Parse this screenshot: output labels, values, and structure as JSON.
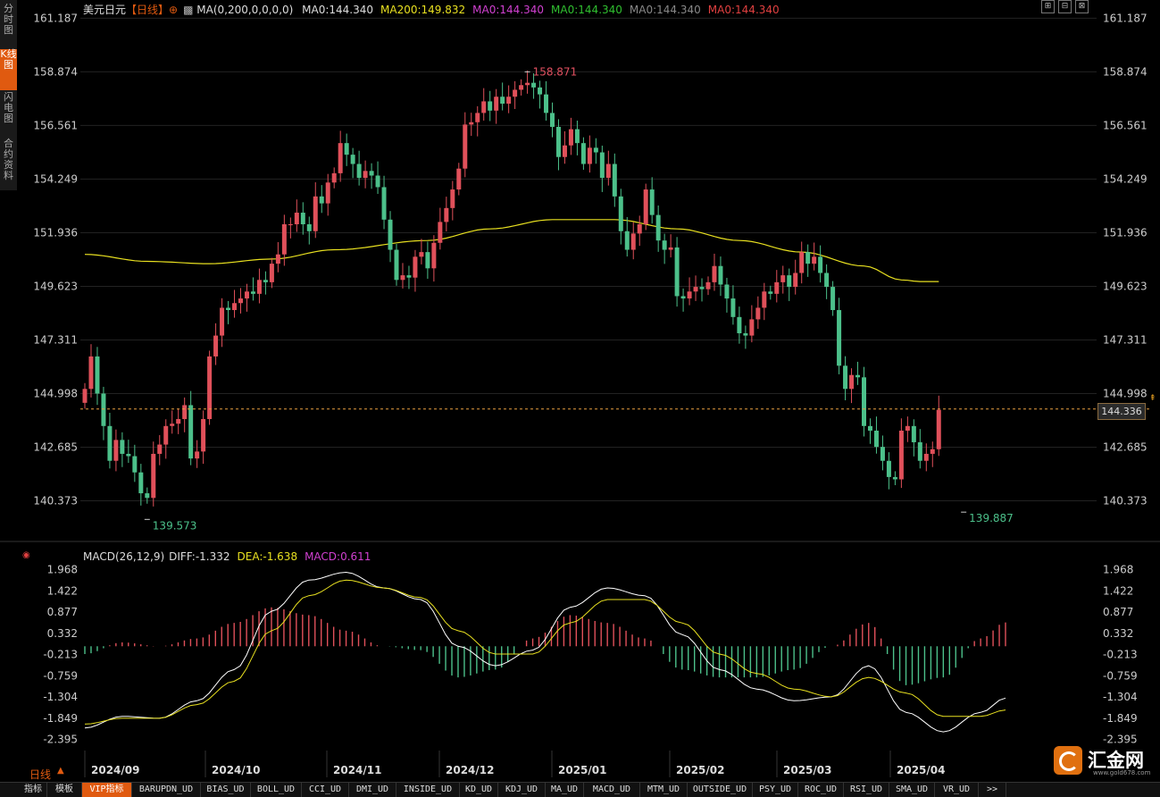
{
  "side_tabs": [
    {
      "label": "分时图",
      "active": false
    },
    {
      "label": "K线图",
      "active": true
    },
    {
      "label": "闪电图",
      "active": false
    },
    {
      "label": "合约资料",
      "active": false
    }
  ],
  "legend_main": {
    "symbol": "美元日元",
    "period": "【日线】",
    "ma_params": "MA(0,200,0,0,0,0)",
    "items": [
      {
        "text": "MA0:144.340",
        "color": "#dddddd"
      },
      {
        "text": "MA200:149.832",
        "color": "#e8e020"
      },
      {
        "text": "MA0:144.340",
        "color": "#d040d0"
      },
      {
        "text": "MA0:144.340",
        "color": "#30c030"
      },
      {
        "text": "MA0:144.340",
        "color": "#888888"
      },
      {
        "text": "MA0:144.340",
        "color": "#e04040"
      }
    ]
  },
  "legend_macd": {
    "name": "MACD(26,12,9)",
    "diff": "DIFF:-1.332",
    "dea": "DEA:-1.638",
    "macd": "MACD:0.611"
  },
  "current_price": "144.336",
  "high_label": "158.871",
  "low_labels": [
    "139.573",
    "139.887"
  ],
  "period_label": "日线",
  "window_buttons": [
    "⊞",
    "⊟",
    "⊠"
  ],
  "bottom_tabs": [
    "指标",
    "模板",
    "VIP指标",
    "BARUPDN_UD",
    "BIAS_UD",
    "BOLL_UD",
    "CCI_UD",
    "DMI_UD",
    "INSIDE_UD",
    "KD_UD",
    "KDJ_UD",
    "MA_UD",
    "MACD_UD",
    "MTM_UD",
    "OUTSIDE_UD",
    "PSY_UD",
    "ROC_UD",
    "RSI_UD",
    "SMA_UD",
    "VR_UD",
    ">>"
  ],
  "logo": {
    "text": "汇金网",
    "sub": "www.gold678.com"
  },
  "colors": {
    "up": "#e0505a",
    "down": "#4cc08a",
    "ma200": "#e8e020",
    "diff": "#ffffff",
    "dea": "#e8e020",
    "grid": "#222222"
  },
  "chart_data": [
    {
      "type": "candlestick",
      "y_ticks": [
        "161.187",
        "158.874",
        "156.561",
        "154.249",
        "151.936",
        "149.623",
        "147.311",
        "144.998",
        "142.685",
        "140.373"
      ],
      "ylim": [
        139.2,
        161.2
      ],
      "x_ticks": [
        "2024/09",
        "2024/10",
        "2024/11",
        "2024/12",
        "2025/01",
        "2025/02",
        "2025/03",
        "2025/04"
      ],
      "closes": [
        145.2,
        146.6,
        145.0,
        143.6,
        142.1,
        143.0,
        142.4,
        142.3,
        141.6,
        140.7,
        140.5,
        142.4,
        142.8,
        143.6,
        143.7,
        143.9,
        144.5,
        142.2,
        142.5,
        143.9,
        146.6,
        147.5,
        148.7,
        148.6,
        148.9,
        149.1,
        149.4,
        149.3,
        149.9,
        149.8,
        150.6,
        151.0,
        152.3,
        152.3,
        152.8,
        152.3,
        152.0,
        153.5,
        153.2,
        154.1,
        154.5,
        155.8,
        155.3,
        154.9,
        154.3,
        154.6,
        154.4,
        153.9,
        152.5,
        151.2,
        149.9,
        150.1,
        150.0,
        150.9,
        151.1,
        150.4,
        151.5,
        152.4,
        153.0,
        153.8,
        154.7,
        156.6,
        156.7,
        157.1,
        157.6,
        157.2,
        157.8,
        157.5,
        157.8,
        158.1,
        158.3,
        158.4,
        158.2,
        157.9,
        157.1,
        156.5,
        155.2,
        155.7,
        156.4,
        155.8,
        154.9,
        155.6,
        155.4,
        154.3,
        154.9,
        153.5,
        152.0,
        151.2,
        151.9,
        152.3,
        153.8,
        152.7,
        151.6,
        151.2,
        151.3,
        149.2,
        149.1,
        149.4,
        149.6,
        149.5,
        149.8,
        150.5,
        149.7,
        149.1,
        148.3,
        147.6,
        147.5,
        148.2,
        148.7,
        149.4,
        149.3,
        149.8,
        150.1,
        149.6,
        150.2,
        151.1,
        150.6,
        150.9,
        150.2,
        149.6,
        148.6,
        146.2,
        145.2,
        145.8,
        145.7,
        143.6,
        143.4,
        142.7,
        142.1,
        141.4,
        141.3,
        143.4,
        143.6,
        142.9,
        142.1,
        142.4,
        142.6,
        144.3
      ],
      "ma200_anchors": [
        [
          0,
          151.0
        ],
        [
          10,
          150.7
        ],
        [
          20,
          150.6
        ],
        [
          30,
          150.8
        ],
        [
          40,
          151.2
        ],
        [
          55,
          151.6
        ],
        [
          65,
          152.1
        ],
        [
          75,
          152.5
        ],
        [
          85,
          152.5
        ],
        [
          95,
          152.1
        ],
        [
          105,
          151.6
        ],
        [
          115,
          151.1
        ],
        [
          125,
          150.5
        ],
        [
          131,
          149.9
        ],
        [
          134,
          149.832
        ]
      ]
    },
    {
      "type": "macd",
      "y_ticks": [
        "1.968",
        "1.422",
        "0.877",
        "0.332",
        "-0.213",
        "-0.759",
        "-1.304",
        "-1.849",
        "-2.395"
      ],
      "ylim": [
        -2.45,
        2.05
      ],
      "diff_anchors": [
        [
          0,
          -2.1
        ],
        [
          6,
          -1.8
        ],
        [
          12,
          -1.85
        ],
        [
          18,
          -1.4
        ],
        [
          24,
          -0.6
        ],
        [
          30,
          0.9
        ],
        [
          36,
          1.7
        ],
        [
          42,
          1.9
        ],
        [
          48,
          1.5
        ],
        [
          54,
          1.2
        ],
        [
          60,
          0.0
        ],
        [
          66,
          -0.5
        ],
        [
          72,
          -0.1
        ],
        [
          78,
          1.0
        ],
        [
          84,
          1.5
        ],
        [
          90,
          1.3
        ],
        [
          96,
          0.3
        ],
        [
          102,
          -0.6
        ],
        [
          108,
          -1.1
        ],
        [
          114,
          -1.4
        ],
        [
          120,
          -1.3
        ],
        [
          126,
          -0.5
        ],
        [
          132,
          -1.7
        ],
        [
          138,
          -2.2
        ],
        [
          144,
          -1.7
        ],
        [
          148,
          -1.332
        ]
      ],
      "dea_anchors": [
        [
          0,
          -2.0
        ],
        [
          6,
          -1.85
        ],
        [
          12,
          -1.85
        ],
        [
          18,
          -1.5
        ],
        [
          24,
          -0.9
        ],
        [
          30,
          0.4
        ],
        [
          36,
          1.3
        ],
        [
          42,
          1.7
        ],
        [
          48,
          1.5
        ],
        [
          54,
          1.25
        ],
        [
          60,
          0.4
        ],
        [
          66,
          -0.2
        ],
        [
          72,
          -0.2
        ],
        [
          78,
          0.6
        ],
        [
          84,
          1.2
        ],
        [
          90,
          1.2
        ],
        [
          96,
          0.6
        ],
        [
          102,
          -0.2
        ],
        [
          108,
          -0.7
        ],
        [
          114,
          -1.1
        ],
        [
          120,
          -1.3
        ],
        [
          126,
          -0.8
        ],
        [
          132,
          -1.2
        ],
        [
          138,
          -1.8
        ],
        [
          144,
          -1.8
        ],
        [
          148,
          -1.638
        ]
      ],
      "final": {
        "diff": -1.332,
        "dea": -1.638,
        "macd": 0.611
      }
    }
  ]
}
